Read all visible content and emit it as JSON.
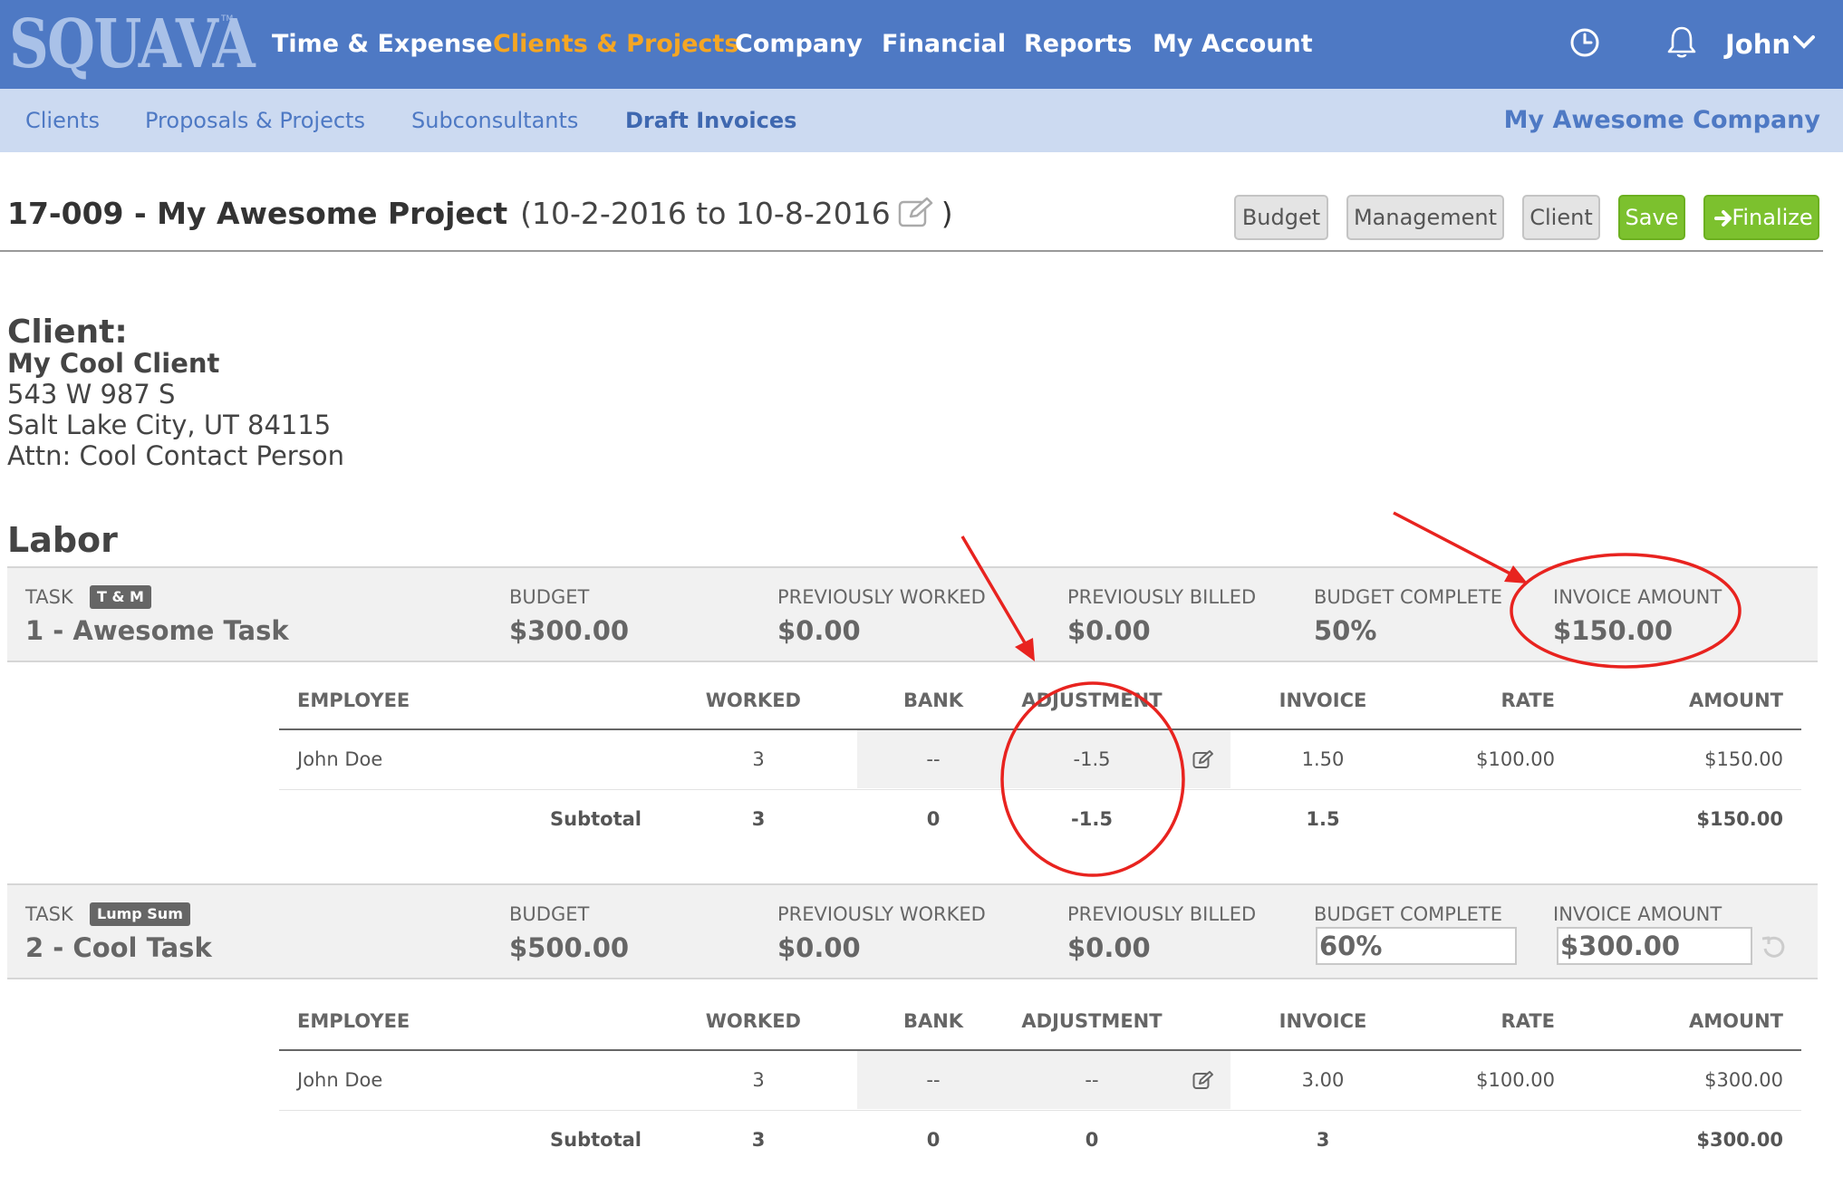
{
  "app": {
    "logo": "SQUAVA",
    "logo_tm": "TM",
    "nav": [
      "Time & Expense",
      "Clients & Projects",
      "Company",
      "Financial",
      "Reports",
      "My Account"
    ],
    "active_nav": "Clients & Projects",
    "user": "John"
  },
  "subnav": {
    "items": [
      "Clients",
      "Proposals & Projects",
      "Subconsultants",
      "Draft Invoices"
    ],
    "active": "Draft Invoices",
    "company": "My Awesome Company"
  },
  "header": {
    "project": "17-009 - My Awesome Project",
    "dates_open": "(10-2-2016 to 10-8-2016",
    "dates_close": ")",
    "buttons": {
      "budget": "Budget",
      "management": "Management",
      "client": "Client",
      "save": "Save",
      "finalize": "Finalize"
    }
  },
  "client": {
    "heading": "Client:",
    "name": "My Cool Client",
    "address1": "543 W 987 S",
    "address2": "Salt Lake City, UT 84115",
    "attn": "Attn: Cool Contact Person"
  },
  "labor": {
    "heading": "Labor",
    "labels": {
      "task": "TASK",
      "budget": "BUDGET",
      "prev_worked": "PREVIOUSLY WORKED",
      "prev_billed": "PREVIOUSLY BILLED",
      "budget_complete": "BUDGET COMPLETE",
      "invoice_amount": "INVOICE AMOUNT"
    },
    "columns": {
      "employee": "EMPLOYEE",
      "worked": "WORKED",
      "bank": "BANK",
      "adjustment": "ADJUSTMENT",
      "invoice": "INVOICE",
      "rate": "RATE",
      "amount": "AMOUNT"
    },
    "subtotal_label": "Subtotal",
    "tasks": [
      {
        "badge": "T & M",
        "name": "1 - Awesome Task",
        "budget": "$300.00",
        "prev_worked": "$0.00",
        "prev_billed": "$0.00",
        "budget_complete": "50%",
        "invoice_amount": "$150.00",
        "row": {
          "employee": "John Doe",
          "worked": "3",
          "bank": "--",
          "adjustment": "-1.5",
          "invoice": "1.50",
          "rate": "$100.00",
          "amount": "$150.00"
        },
        "subtotal": {
          "worked": "3",
          "bank": "0",
          "adjustment": "-1.5",
          "invoice": "1.5",
          "amount": "$150.00"
        }
      },
      {
        "badge": "Lump Sum",
        "name": "2 - Cool Task",
        "budget": "$500.00",
        "prev_worked": "$0.00",
        "prev_billed": "$0.00",
        "budget_complete": "60%",
        "invoice_amount": "$300.00",
        "row": {
          "employee": "John Doe",
          "worked": "3",
          "bank": "--",
          "adjustment": "--",
          "invoice": "3.00",
          "rate": "$100.00",
          "amount": "$300.00"
        },
        "subtotal": {
          "worked": "3",
          "bank": "0",
          "adjustment": "0",
          "invoice": "3",
          "amount": "$300.00"
        }
      }
    ]
  },
  "colors": {
    "nav_bg": "#4e79c4",
    "subnav_bg": "#ccdaf1",
    "active_nav": "#f5a623",
    "green": "#7cc12e",
    "annotation": "#e8231f"
  },
  "icons": [
    "clock-icon",
    "bell-icon",
    "chevron-down-icon",
    "edit-icon",
    "pencil-icon",
    "arrow-right-icon",
    "undo-icon"
  ]
}
